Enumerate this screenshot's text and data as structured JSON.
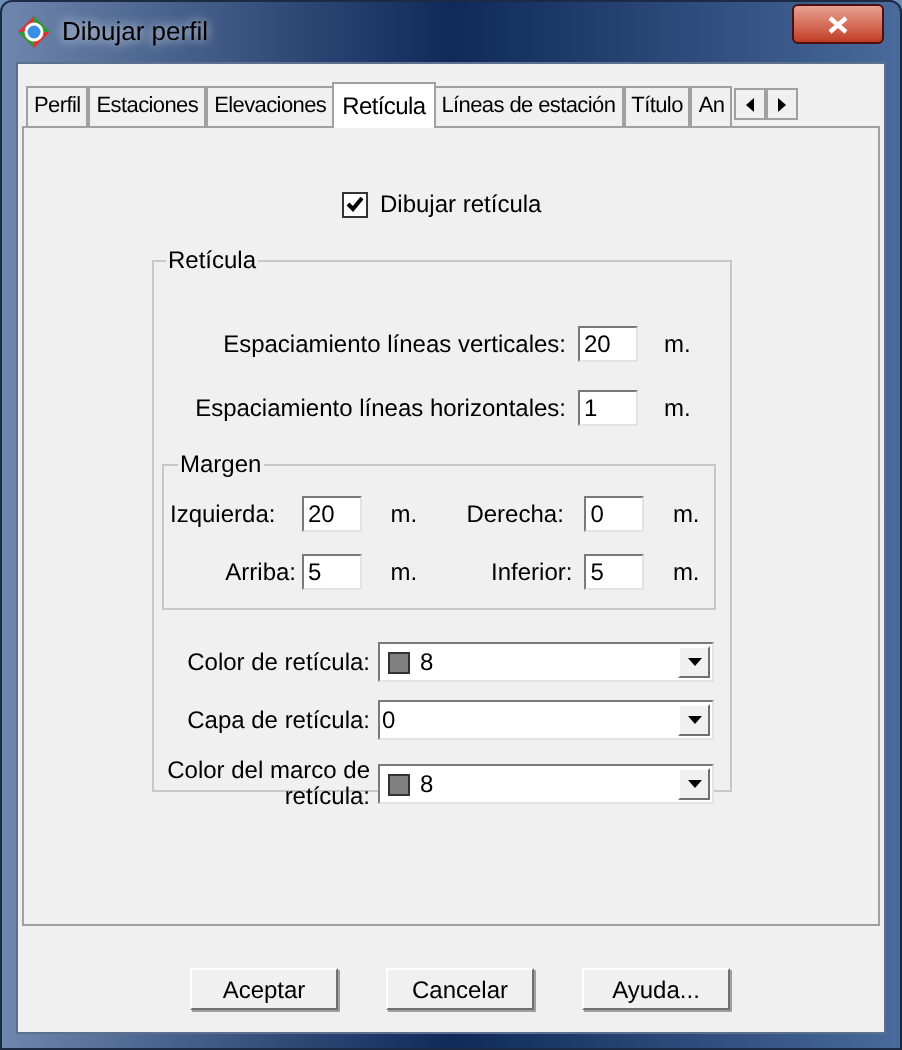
{
  "window": {
    "title": "Dibujar perfil"
  },
  "tabs": [
    {
      "label": "Perfil",
      "selected": false
    },
    {
      "label": "Estaciones",
      "selected": false
    },
    {
      "label": "Elevaciones",
      "selected": false
    },
    {
      "label": "Retícula",
      "selected": true
    },
    {
      "label": "Líneas de estación",
      "selected": false
    },
    {
      "label": "Título",
      "selected": false
    },
    {
      "label": "An",
      "selected": false
    }
  ],
  "draw_grid": {
    "label": "Dibujar retícula",
    "checked": true
  },
  "grid_group": {
    "title": "Retícula",
    "spacing": [
      {
        "label": "Espaciamiento líneas verticales:",
        "value": "20",
        "unit": "m."
      },
      {
        "label": "Espaciamiento líneas horizontales:",
        "value": "1",
        "unit": "m."
      }
    ],
    "margin": {
      "title": "Margen",
      "fields": [
        {
          "label": "Izquierda:",
          "value": "20",
          "unit": "m."
        },
        {
          "label": "Derecha:",
          "value": "0",
          "unit": "m."
        },
        {
          "label": "Arriba:",
          "value": "5",
          "unit": "m."
        },
        {
          "label": "Inferior:",
          "value": "5",
          "unit": "m."
        }
      ]
    },
    "combos": [
      {
        "label": "Color de retícula:",
        "value": "8",
        "kind": "color",
        "color": "#808080"
      },
      {
        "label": "Capa de retícula:",
        "value": "0",
        "kind": "text"
      },
      {
        "label": "Color del marco de retícula:",
        "value": "8",
        "kind": "color",
        "color": "#808080"
      }
    ]
  },
  "buttons": [
    "Aceptar",
    "Cancelar",
    "Ayuda..."
  ]
}
